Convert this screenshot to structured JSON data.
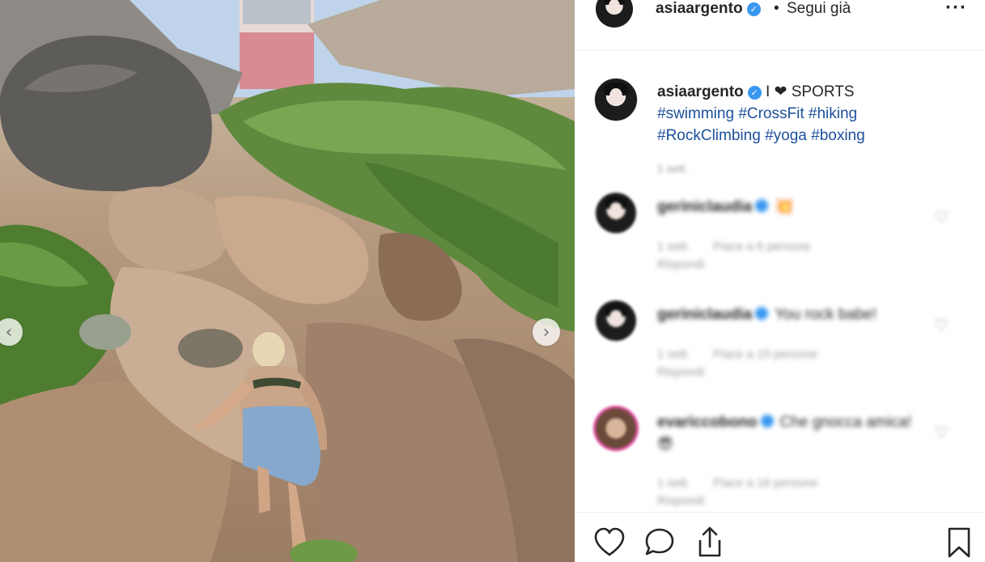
{
  "post": {
    "username": "asiaargento",
    "follow_status": "Segui già",
    "separator": "•"
  },
  "caption": {
    "username": "asiaargento",
    "text": "I ❤ SPORTS",
    "hashtags": [
      "#swimming",
      "#CrossFit",
      "#hiking",
      "#RockClimbing",
      "#yoga",
      "#boxing"
    ],
    "time": "1 sett."
  },
  "comments": [
    {
      "username": "gerinicla​udia",
      "text": "💥",
      "time": "1 sett.",
      "likes": "Piace a 6 persone",
      "reply": "Rispondi"
    },
    {
      "username": "gerinicla​udia",
      "text": "You rock babe!",
      "time": "1 sett.",
      "likes": "Piace a 15 persone",
      "reply": "Rispondi"
    },
    {
      "username": "evariccobono",
      "text": "Che gnocca amica! 😎",
      "time": "1 sett.",
      "likes": "Piace a 16 persone",
      "reply": "Rispondi"
    }
  ],
  "icons": {
    "more": "more-options-icon",
    "prev": "chevron-left-icon",
    "next": "chevron-right-icon",
    "like": "heart-icon",
    "comment": "comment-bubble-icon",
    "share": "share-icon",
    "save": "bookmark-icon"
  },
  "colors": {
    "verified": "#3897f0",
    "hashtag": "#1b4f9c",
    "story_ring": "#e2449d"
  }
}
